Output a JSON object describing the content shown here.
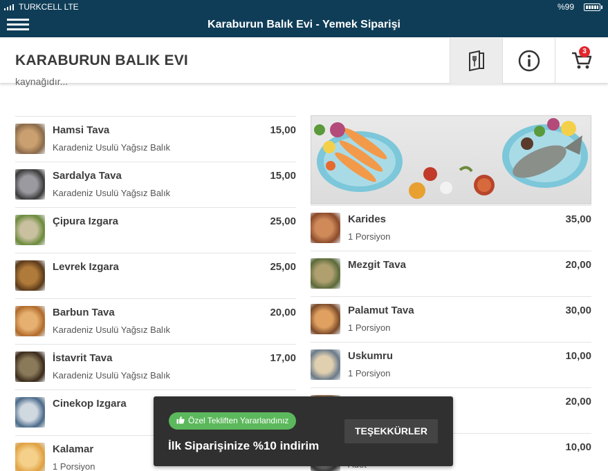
{
  "status_bar": {
    "carrier": "TURKCELL LTE",
    "battery": "%99"
  },
  "title_bar": {
    "title": "Karaburun Balık Evi - Yemek Siparişi"
  },
  "header": {
    "restaurant_name": "KARABURUN BALIK EVI",
    "cart_count": "3"
  },
  "intro_text": "kaynağıdır...",
  "left_menu": [
    {
      "name": "Hamsi Tava",
      "desc": "Karadeniz Usulü Yağsız Balık",
      "price": "15,00"
    },
    {
      "name": "Sardalya Tava",
      "desc": "Karadeniz Usulü Yağsız Balık",
      "price": "15,00"
    },
    {
      "name": "Çipura Izgara",
      "desc": "",
      "price": "25,00"
    },
    {
      "name": "Levrek Izgara",
      "desc": "",
      "price": "25,00"
    },
    {
      "name": "Barbun Tava",
      "desc": "Karadeniz Usulü Yağsız Balık",
      "price": "20,00"
    },
    {
      "name": "İstavrit Tava",
      "desc": "Karadeniz Usulü Yağsız Balık",
      "price": "17,00"
    },
    {
      "name": "Cinekop Izgara",
      "desc": "",
      "price": ""
    },
    {
      "name": "Kalamar",
      "desc": "1 Porsiyon",
      "price": ""
    }
  ],
  "right_menu": [
    {
      "name": "Karides",
      "desc": "1 Porsiyon",
      "price": "35,00"
    },
    {
      "name": "Mezgit Tava",
      "desc": "",
      "price": "20,00"
    },
    {
      "name": "Palamut Tava",
      "desc": "1 Porsiyon",
      "price": "30,00"
    },
    {
      "name": "Uskumru",
      "desc": "1 Porsiyon",
      "price": "10,00"
    },
    {
      "name": "",
      "desc": "",
      "price": "20,00"
    },
    {
      "name": "",
      "desc": "Adet",
      "price": "10,00"
    }
  ],
  "toast": {
    "offer_label": "Özel Tekliften Yararlandınız",
    "message": "İlk Siparişinize %10 indirim",
    "button": "TEŞEKKÜRLER"
  },
  "colors": {
    "bar": "#0f3d57",
    "badge": "#e4252e",
    "offer_green": "#5cb85c",
    "toast_bg": "#303030"
  }
}
